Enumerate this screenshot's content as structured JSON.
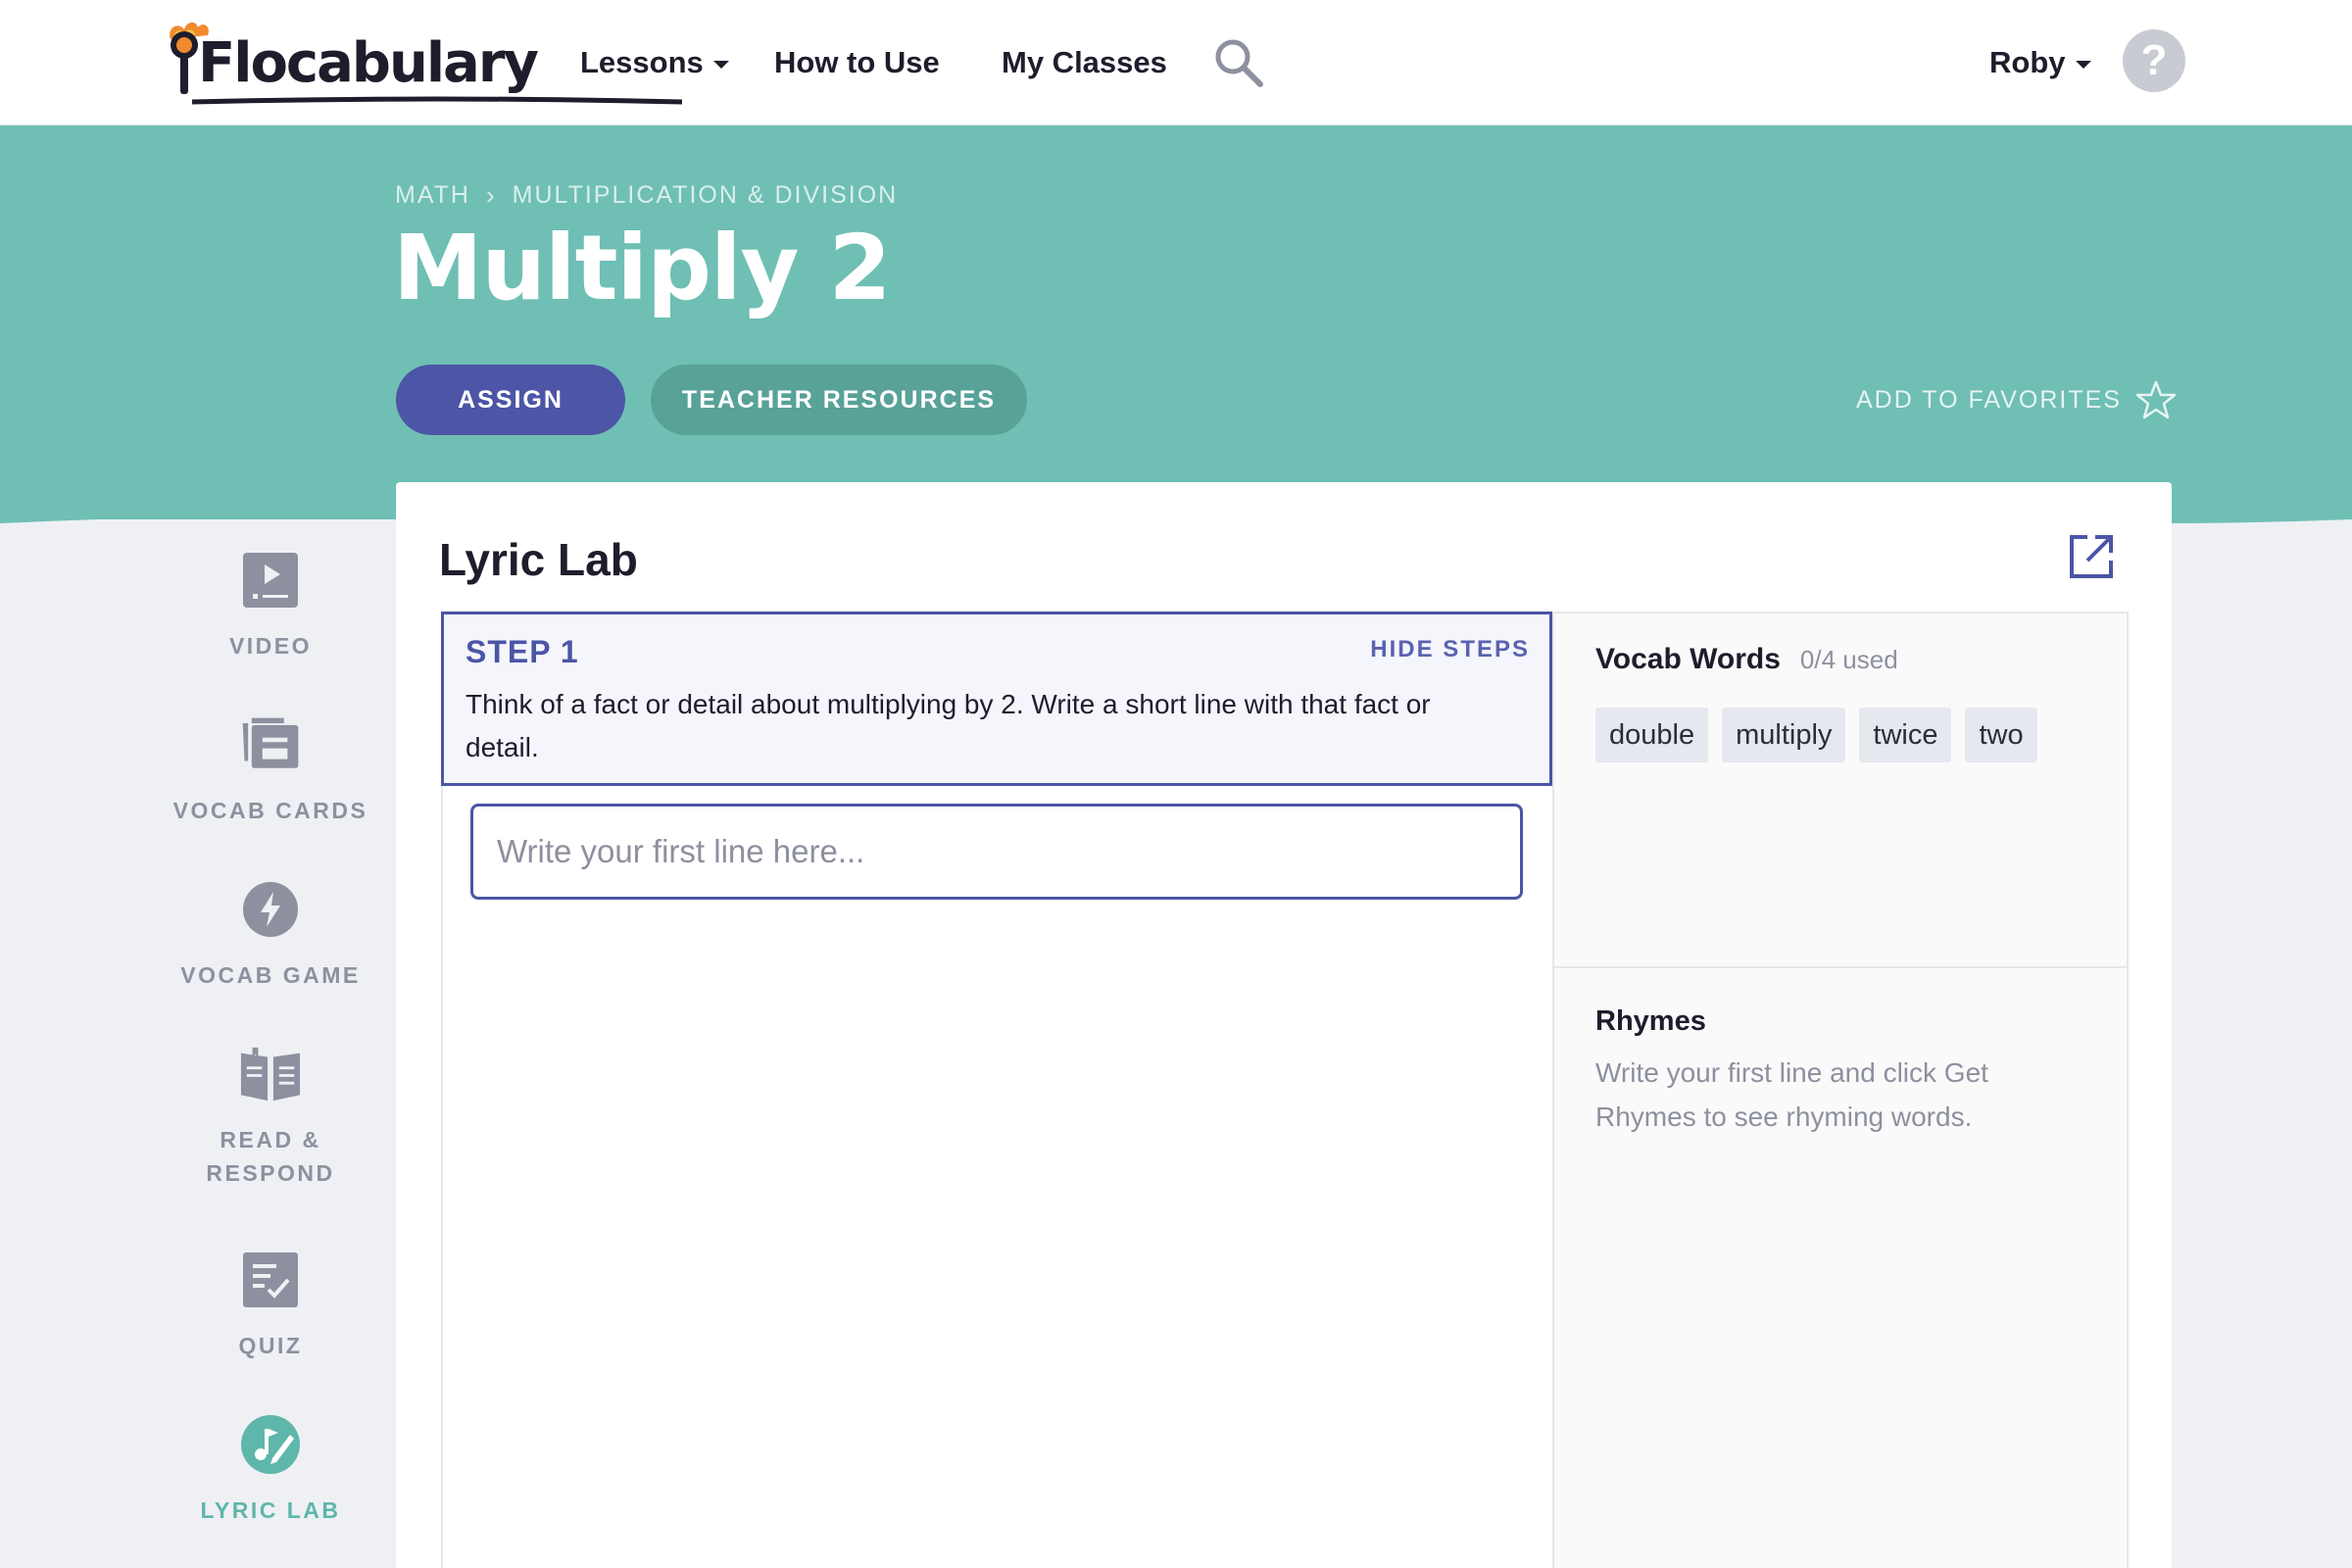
{
  "nav": {
    "logo_text": "Flocabulary",
    "lessons": "Lessons",
    "how_to_use": "How to Use",
    "my_classes": "My Classes",
    "user": "Roby",
    "help_glyph": "?"
  },
  "hero": {
    "breadcrumb": [
      "MATH",
      "MULTIPLICATION & DIVISION"
    ],
    "breadcrumb_sep": "›",
    "title": "Multiply 2",
    "assign": "ASSIGN",
    "teacher_resources": "TEACHER RESOURCES",
    "add_to_favorites": "ADD TO FAVORITES"
  },
  "sidebar": {
    "items": [
      {
        "label": "VIDEO",
        "icon": "video-icon"
      },
      {
        "label": "VOCAB CARDS",
        "icon": "vocab-cards-icon"
      },
      {
        "label": "VOCAB GAME",
        "icon": "lightning-icon"
      },
      {
        "label": "READ & RESPOND",
        "icon": "book-icon"
      },
      {
        "label": "QUIZ",
        "icon": "quiz-icon"
      },
      {
        "label": "LYRIC LAB",
        "icon": "lyric-lab-icon",
        "active": true
      }
    ]
  },
  "lab": {
    "title": "Lyric Lab",
    "step_title": "STEP 1",
    "hide_steps": "HIDE STEPS",
    "step_text": "Think of a fact or detail about multiplying by 2. Write a short line with that fact or detail.",
    "input_placeholder": "Write your first line here...",
    "input_value": ""
  },
  "vocab": {
    "title": "Vocab Words",
    "used": "0/4 used",
    "words": [
      "double",
      "multiply",
      "twice",
      "two"
    ]
  },
  "rhymes": {
    "title": "Rhymes",
    "text": "Write your first line and click Get Rhymes to see rhyming words."
  },
  "colors": {
    "teal": "#6fbfb4",
    "indigo": "#4c55a6",
    "teal_dark": "#58a298",
    "muted": "#8d909e"
  }
}
